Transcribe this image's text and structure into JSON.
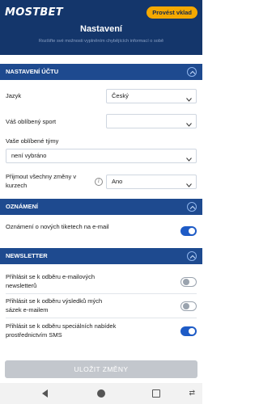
{
  "header": {
    "logo": "MOSTBET",
    "deposit_button": "Provést vklad",
    "title": "Nastavení",
    "subtitle": "Rozšiřte své možnosti vyplněním chybějících informací o sobě"
  },
  "account_section": {
    "title": "NASTAVENÍ ÚČTU",
    "language_label": "Jazyk",
    "language_value": "Český",
    "sport_label": "Váš oblíbený sport",
    "sport_value": "",
    "teams_label": "Vaše oblíbené týmy",
    "teams_value": "není vybráno",
    "odds_label": "Přijmout všechny změny v kurzech",
    "odds_info_icon": "i",
    "odds_value": "Ano"
  },
  "notifications_section": {
    "title": "OZNÁMENÍ",
    "email_tickets_label": "Oznámení o nových tiketech na e-mail",
    "email_tickets_on": true
  },
  "newsletter_section": {
    "title": "NEWSLETTER",
    "items": [
      {
        "label": "Přihlásit se k odběru e-mailových newsletterů",
        "on": false
      },
      {
        "label": "Přihlásit se k odběru výsledků mých sázek e-mailem",
        "on": false
      },
      {
        "label": "Přihlásit se k odběru speciálních nabídek prostřednictvím SMS",
        "on": true
      }
    ]
  },
  "save_button": "ULOŽIT ZMĚNY",
  "colors": {
    "header_bg": "#14366b",
    "section_bg": "#1e4a8f",
    "accent": "#1e5bc6",
    "deposit": "#f5a900"
  }
}
